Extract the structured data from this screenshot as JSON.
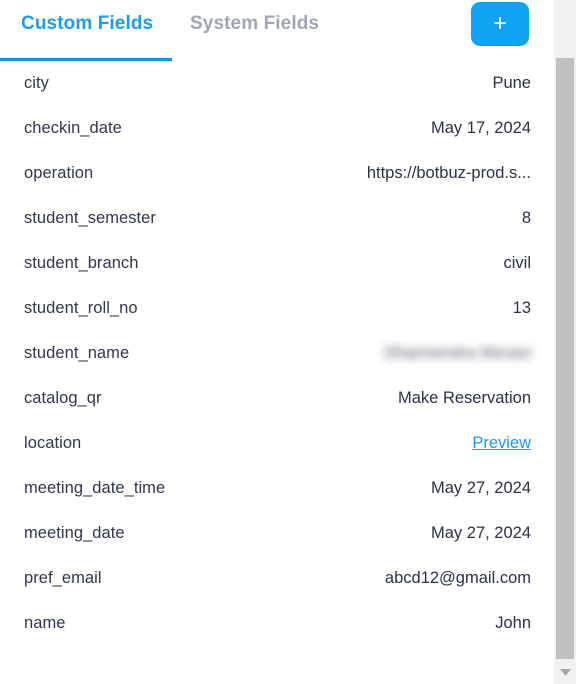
{
  "tabs": [
    {
      "id": "custom-fields",
      "label": "Custom Fields",
      "active": true
    },
    {
      "id": "system-fields",
      "label": "System Fields",
      "active": false
    }
  ],
  "toolbar": {
    "add_button_label": "+",
    "add_button_icon": "plus-icon",
    "accent_color": "#11a2f3"
  },
  "colors": {
    "active_tab": "#1c9cf0",
    "inactive_tab": "#9ea7b3",
    "underline": "#0a95e8",
    "link": "#2196f3",
    "label_text": "#32384a",
    "value_text": "#2b3242",
    "scrollbar_track": "#f1f1f1",
    "scrollbar_thumb": "#c1c1c1"
  },
  "fields": [
    {
      "name": "city",
      "value": "Pune",
      "type": "text"
    },
    {
      "name": "checkin_date",
      "value": "May 17, 2024",
      "type": "text"
    },
    {
      "name": "operation",
      "value": "https://botbuz-prod.s...",
      "type": "text"
    },
    {
      "name": "student_semester",
      "value": "8",
      "type": "text"
    },
    {
      "name": "student_branch",
      "value": "civil",
      "type": "text"
    },
    {
      "name": "student_roll_no",
      "value": "13",
      "type": "text"
    },
    {
      "name": "student_name",
      "value": "Dharmendra Morani",
      "type": "redacted"
    },
    {
      "name": "catalog_qr",
      "value": "Make Reservation",
      "type": "text"
    },
    {
      "name": "location",
      "value": "Preview",
      "type": "link"
    },
    {
      "name": "meeting_date_time",
      "value": "May 27, 2024",
      "type": "text"
    },
    {
      "name": "meeting_date",
      "value": "May 27, 2024",
      "type": "text"
    },
    {
      "name": "pref_email",
      "value": "abcd12@gmail.com",
      "type": "text"
    },
    {
      "name": "name",
      "value": "John",
      "type": "text"
    }
  ],
  "scrollbar": {
    "down_arrow_icon": "chevron-down-icon"
  }
}
